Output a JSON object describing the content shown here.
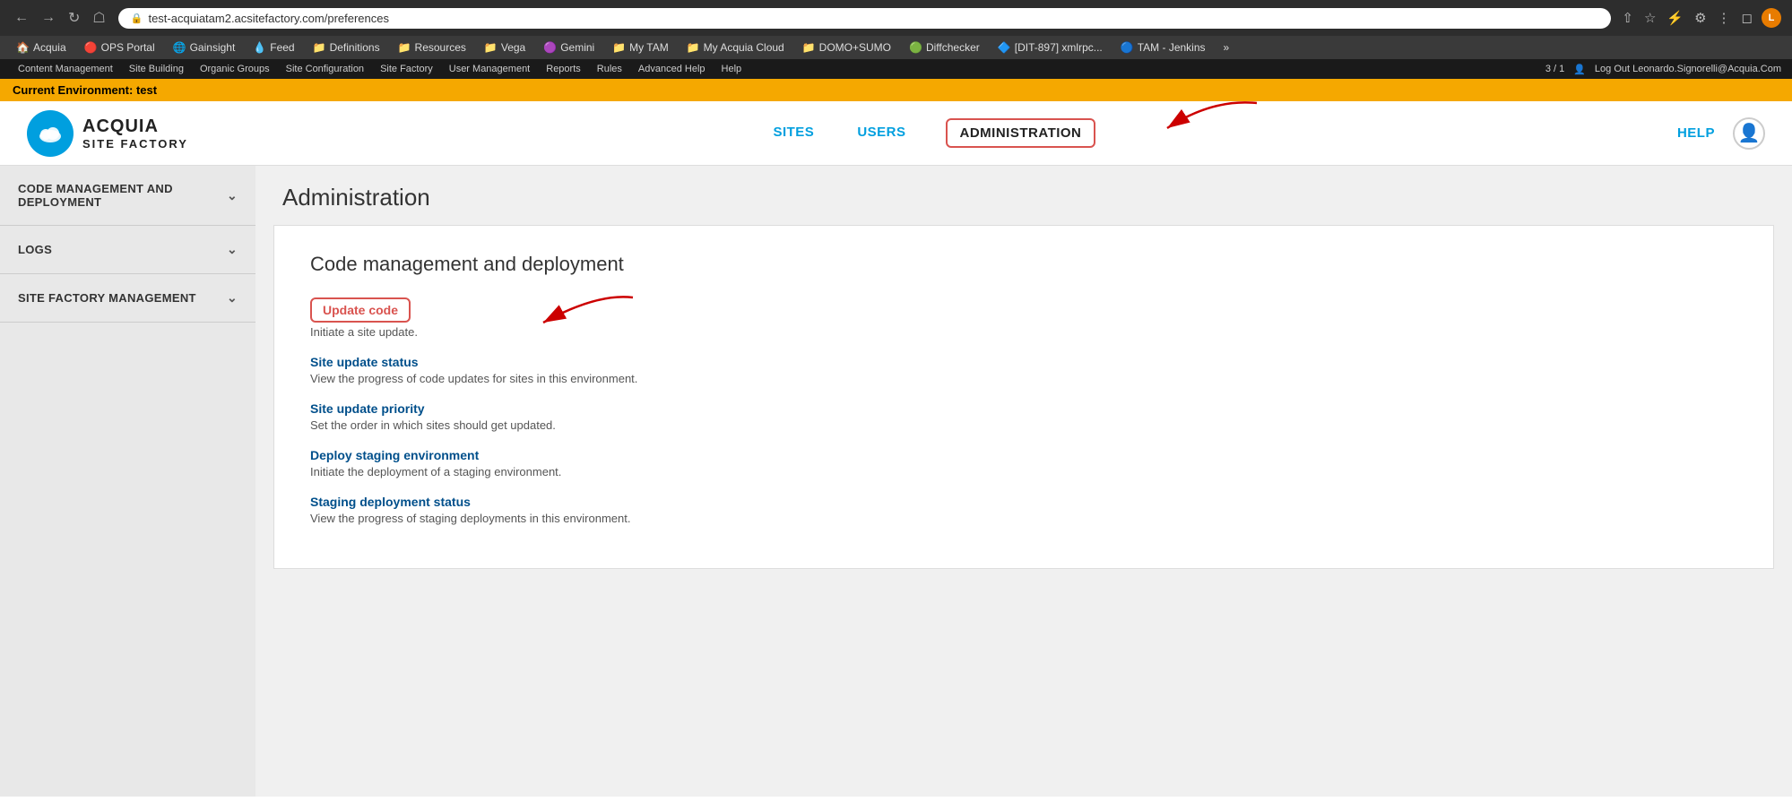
{
  "browser": {
    "url": "test-acquiatam2.acsitefactory.com/preferences",
    "back_title": "←",
    "forward_title": "→",
    "reload_title": "↻",
    "home_title": "⌂",
    "profile_initial": "L"
  },
  "bookmarks": [
    {
      "label": "Acquia",
      "icon": "🏠"
    },
    {
      "label": "OPS Portal",
      "icon": "🔴"
    },
    {
      "label": "Gainsight",
      "icon": "🌐"
    },
    {
      "label": "Feed",
      "icon": "💧"
    },
    {
      "label": "Definitions",
      "icon": "📁"
    },
    {
      "label": "Resources",
      "icon": "📁"
    },
    {
      "label": "Vega",
      "icon": "📁"
    },
    {
      "label": "Gemini",
      "icon": "🟣"
    },
    {
      "label": "My TAM",
      "icon": "📁"
    },
    {
      "label": "My Acquia Cloud",
      "icon": "📁"
    },
    {
      "label": "DOMO+SUMO",
      "icon": "📁"
    },
    {
      "label": "Diffchecker",
      "icon": "🟢"
    },
    {
      "label": "[DIT-897] xmlrpc...",
      "icon": "🔷"
    },
    {
      "label": "TAM - Jenkins",
      "icon": "🔵"
    },
    {
      "label": "»",
      "icon": ""
    }
  ],
  "drupal_bar": {
    "items": [
      "Content Management",
      "Site Building",
      "Organic Groups",
      "Site Configuration",
      "Site Factory",
      "User Management",
      "Reports",
      "Rules",
      "Advanced Help",
      "Help"
    ],
    "page_info": "3 / 1",
    "user_text": "Log Out Leonardo.Signorelli@Acquia.Com"
  },
  "env_banner": "Current Environment: test",
  "header": {
    "logo_acquia": "ACQUIA",
    "logo_sitefactory": "SITE FACTORY",
    "nav_items": [
      {
        "label": "SITES",
        "active": false,
        "highlighted": false
      },
      {
        "label": "USERS",
        "active": false,
        "highlighted": false
      },
      {
        "label": "ADMINISTRATION",
        "active": true,
        "highlighted": true
      }
    ],
    "help_label": "HELP"
  },
  "sidebar": {
    "sections": [
      {
        "label": "CODE MANAGEMENT AND DEPLOYMENT"
      },
      {
        "label": "LOGS"
      },
      {
        "label": "SITE FACTORY MANAGEMENT"
      }
    ]
  },
  "page": {
    "title": "Administration",
    "section_title": "Code management and deployment",
    "items": [
      {
        "label": "Update code",
        "description": "Initiate a site update.",
        "highlighted": true
      },
      {
        "label": "Site update status",
        "description": "View the progress of code updates for sites in this environment.",
        "highlighted": false
      },
      {
        "label": "Site update priority",
        "description": "Set the order in which sites should get updated.",
        "highlighted": false
      },
      {
        "label": "Deploy staging environment",
        "description": "Initiate the deployment of a staging environment.",
        "highlighted": false
      },
      {
        "label": "Staging deployment status",
        "description": "View the progress of staging deployments in this environment.",
        "highlighted": false
      }
    ]
  }
}
